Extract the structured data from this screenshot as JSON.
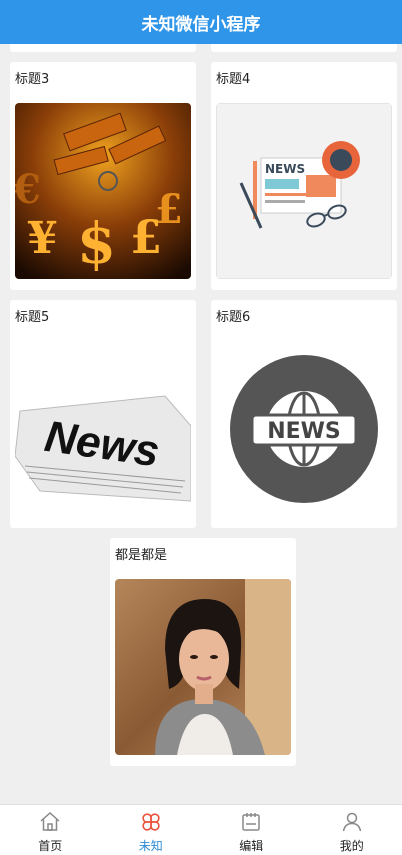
{
  "navbar": {
    "title": "未知微信小程序"
  },
  "cards": [
    {
      "title": "标题3",
      "image": "gold-currency-symbols"
    },
    {
      "title": "标题4",
      "image": "news-flat-illustration"
    },
    {
      "title": "标题5",
      "image": "news-newspaper"
    },
    {
      "title": "标题6",
      "image": "news-globe-badge"
    },
    {
      "title": "都是都是",
      "image": "portrait-woman"
    }
  ],
  "tabbar": {
    "items": [
      {
        "label": "首页",
        "icon": "home-icon",
        "active": false
      },
      {
        "label": "未知",
        "icon": "clover-icon",
        "active": true
      },
      {
        "label": "编辑",
        "icon": "notepad-icon",
        "active": false
      },
      {
        "label": "我的",
        "icon": "user-icon",
        "active": false
      }
    ]
  },
  "colors": {
    "navbar": "#2f95e8",
    "active_tab": "#2e8bd6",
    "active_icon": "#e8533b"
  }
}
